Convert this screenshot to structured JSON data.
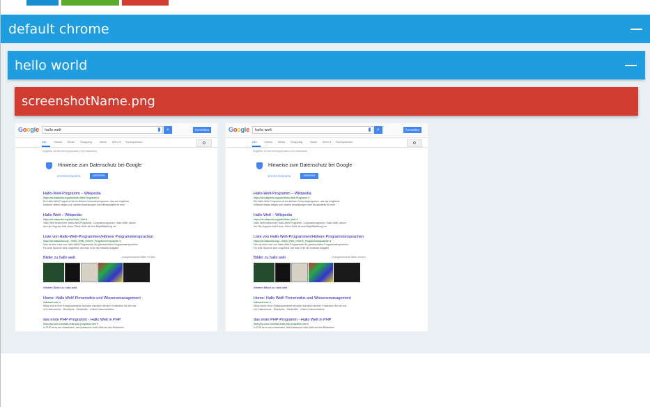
{
  "top_tabs": [
    {
      "name": "tab-blue",
      "color": "#1a8fd0"
    },
    {
      "name": "tab-green",
      "color": "#5bab2c"
    },
    {
      "name": "tab-red",
      "color": "#d23b30"
    }
  ],
  "panels": {
    "browser_title": "default chrome",
    "suite_title": "hello world",
    "screenshot_title": "screenshotName.png"
  },
  "colors": {
    "panel_blue": "#1e9ee0",
    "panel_red": "#d23b30",
    "panel_bg": "#e8f0f3"
  },
  "icons": {
    "collapse": "minus-icon"
  },
  "thumbnails": [
    {
      "search_query": "hallo welt",
      "signin_label": "Anmelden",
      "nav": [
        "Alle",
        "Videos",
        "Bilder",
        "Shopping",
        "News",
        "Mehr ▾",
        "Suchoptionen"
      ],
      "result_count": "Ungefähr 15 000 000 Ergebnisse (0,32 Sekunden)",
      "privacy_title": "Hinweise zum Datenschutz bei Google",
      "later_label": "SPÄTER ERINNERN",
      "view_label": "ANSEHEN",
      "results": [
        {
          "title": "Hallo-Welt-Programm – Wikipedia",
          "url": "https://de.wikipedia.org/wiki/Hallo-Welt-Programm ▾",
          "snippet": "Ein Hallo-Welt-Programm ist ein kleines Computerprogramm, das auf möglichst",
          "snippet2": "einfache Weise zeigen soll, welche Anweisungen oder Bestandteile für eine"
        },
        {
          "title": "Hallo Welt – Wikipedia",
          "url": "https://de.wikipedia.org/wiki/Hallo_Welt ▾",
          "snippet": "Hallo Welt bezeichnet: Hallo-Welt-Programm, Computerprogramm. Hallo Welt!, Album",
          "snippet2": "der Hip-Hoppers Max Herre. Diese Seite ist eine Begriffsklärung zur"
        },
        {
          "title": "Liste von Hallo-Welt-Programmen/Höhere Programmiersprachen",
          "url": "https://de.wikipedia.org/.../Hallo_Welt/_Höhere_Programmiersprachen ▾",
          "snippet": "Dies ist eine Liste von Hallo-Welt-Programmen für gebräuchliche Programmiersprachen.",
          "snippet2": "Für jede Sprache wird vorgeführt, wie man in ihr die einfache Aufgabe"
        }
      ],
      "images_label": "Bilder zu hallo welt",
      "images_right": "Unangemessene Bilder melden",
      "more_images": "Weitere Bilder zu hallo welt",
      "results2": [
        {
          "title": "Home: Hallo Welt! Firmenwikis und Wissensmanagement",
          "url": "hallowelt.com/ ▾",
          "snippet": "Wikis sind in Ihrer Einsatzszenarien beinahe unendlich flexibel. Entdecken Sie bei uns",
          "snippet2": "Uni Datenschutz · BlueSpice · MediaWiki · Online-Dokumentation"
        },
        {
          "title": "das erste PHP-Programm - Hallo Welt in PHP",
          "url": "www.php-kurs.com/das-erste-php-programm.htm ▾",
          "snippet": "In PHP ist es am einfachsten, das klassische Hallo Welt auf den Bildschirm",
          "snippet2": ""
        }
      ]
    },
    {
      "search_query": "hallo welt",
      "signin_label": "Anmelden",
      "nav": [
        "Alle",
        "Videos",
        "Bilder",
        "Shopping",
        "News",
        "Mehr ▾",
        "Suchoptionen"
      ],
      "result_count": "Ungefähr 15 000 000 Ergebnisse (0,32 Sekunden)",
      "privacy_title": "Hinweise zum Datenschutz bei Google",
      "later_label": "SPÄTER ERINNERN",
      "view_label": "ANSEHEN",
      "results": [
        {
          "title": "Hallo-Welt-Programm – Wikipedia",
          "url": "https://de.wikipedia.org/wiki/Hallo-Welt-Programm ▾",
          "snippet": "Ein Hallo-Welt-Programm ist ein kleines Computerprogramm, das auf möglichst",
          "snippet2": "einfache Weise zeigen soll, welche Anweisungen oder Bestandteile für eine"
        },
        {
          "title": "Hallo Welt – Wikipedia",
          "url": "https://de.wikipedia.org/wiki/Hallo_Welt ▾",
          "snippet": "Hallo Welt bezeichnet: Hallo-Welt-Programm, Computerprogramm. Hallo Welt!, Album",
          "snippet2": "der Hip-Hoppers Max Herre. Diese Seite ist eine Begriffsklärung zur"
        },
        {
          "title": "Liste von Hallo-Welt-Programmen/Höhere Programmiersprachen",
          "url": "https://de.wikipedia.org/.../Hallo_Welt/_Höhere_Programmiersprachen ▾",
          "snippet": "Dies ist eine Liste von Hallo-Welt-Programmen für gebräuchliche Programmiersprachen.",
          "snippet2": "Für jede Sprache wird vorgeführt, wie man in ihr die einfache Aufgabe"
        }
      ],
      "images_label": "Bilder zu hallo welt",
      "images_right": "Unangemessene Bilder melden",
      "more_images": "Weitere Bilder zu hallo welt",
      "results2": [
        {
          "title": "Home: Hallo Welt! Firmenwikis und Wissensmanagement",
          "url": "hallowelt.com/ ▾",
          "snippet": "Wikis sind in Ihrer Einsatzszenarien beinahe unendlich flexibel. Entdecken Sie bei uns",
          "snippet2": "Uni Datenschutz · BlueSpice · MediaWiki · Online-Dokumentation"
        },
        {
          "title": "das erste PHP-Programm - Hallo Welt in PHP",
          "url": "www.php-kurs.com/das-erste-php-programm.htm ▾",
          "snippet": "In PHP ist es am einfachsten, das klassische Hallo Welt auf den Bildschirm",
          "snippet2": ""
        }
      ]
    }
  ]
}
